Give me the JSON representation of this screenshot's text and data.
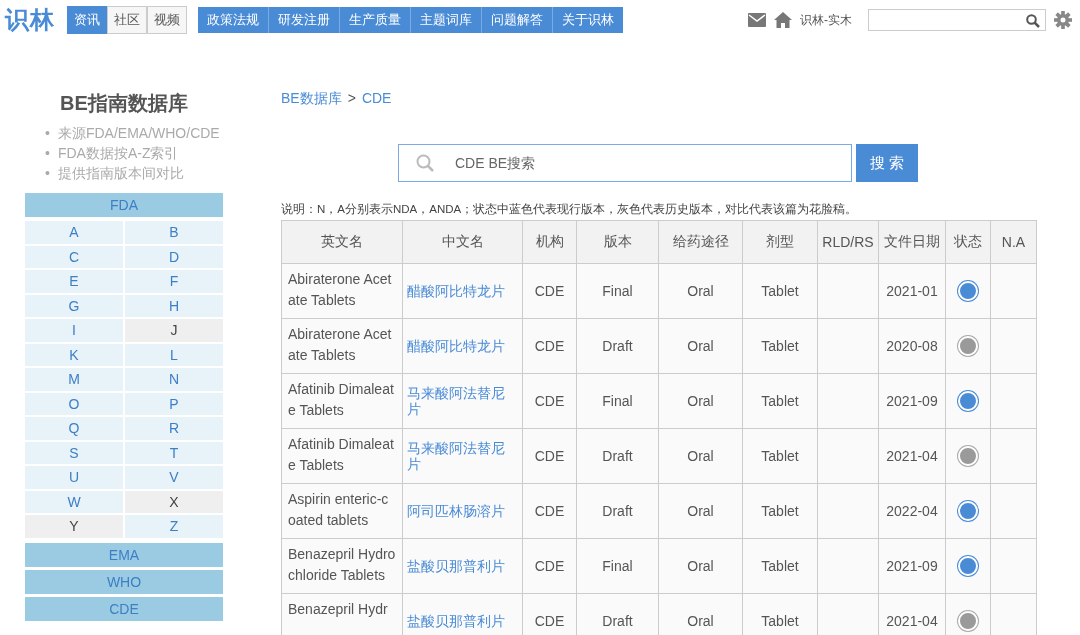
{
  "header": {
    "logo": "识林",
    "tabs": [
      {
        "label": "资讯",
        "selected": true
      },
      {
        "label": "社区",
        "selected": false
      },
      {
        "label": "视频",
        "selected": false
      }
    ],
    "nav": [
      "政策法规",
      "研发注册",
      "生产质量",
      "主题词库",
      "问题解答",
      "关于识林"
    ],
    "user": "识林-实木"
  },
  "sidebar": {
    "title": "BE指南数据库",
    "bullet_marker": "•",
    "bullets": [
      "来源FDA/EMA/WHO/CDE",
      "FDA数据按A-Z索引",
      "提供指南版本间对比"
    ],
    "fda": "FDA",
    "letters": [
      {
        "label": "A",
        "available": true
      },
      {
        "label": "B",
        "available": true
      },
      {
        "label": "C",
        "available": true
      },
      {
        "label": "D",
        "available": true
      },
      {
        "label": "E",
        "available": true
      },
      {
        "label": "F",
        "available": true
      },
      {
        "label": "G",
        "available": true
      },
      {
        "label": "H",
        "available": true
      },
      {
        "label": "I",
        "available": true
      },
      {
        "label": "J",
        "available": false
      },
      {
        "label": "K",
        "available": true
      },
      {
        "label": "L",
        "available": true
      },
      {
        "label": "M",
        "available": true
      },
      {
        "label": "N",
        "available": true
      },
      {
        "label": "O",
        "available": true
      },
      {
        "label": "P",
        "available": true
      },
      {
        "label": "Q",
        "available": true
      },
      {
        "label": "R",
        "available": true
      },
      {
        "label": "S",
        "available": true
      },
      {
        "label": "T",
        "available": true
      },
      {
        "label": "U",
        "available": true
      },
      {
        "label": "V",
        "available": true
      },
      {
        "label": "W",
        "available": true
      },
      {
        "label": "X",
        "available": false
      },
      {
        "label": "Y",
        "available": false
      },
      {
        "label": "Z",
        "available": true
      }
    ],
    "sources": [
      "EMA",
      "WHO",
      "CDE"
    ]
  },
  "breadcrumb": [
    "BE数据库",
    "CDE"
  ],
  "breadcrumb_separator": ">",
  "search": {
    "placeholder": "CDE BE搜索",
    "button": "搜 索"
  },
  "note": "说明：N，A分别表示NDA，ANDA；状态中蓝色代表现行版本，灰色代表历史版本，对比代表该篇为花脸稿。",
  "table": {
    "columns": [
      "英文名",
      "中文名",
      "机构",
      "版本",
      "给药途径",
      "剂型",
      "RLD/RS",
      "文件日期",
      "状态",
      "N.A"
    ],
    "rows": [
      {
        "en": "Abiraterone Acetate Tablets",
        "cn": "醋酸阿比特龙片",
        "agency": "CDE",
        "version": "Final",
        "route": "Oral",
        "form": "Tablet",
        "date": "2021-01",
        "current": true
      },
      {
        "en": "Abiraterone Acetate Tablets",
        "cn": "醋酸阿比特龙片",
        "agency": "CDE",
        "version": "Draft",
        "route": "Oral",
        "form": "Tablet",
        "date": "2020-08",
        "current": false
      },
      {
        "en": "Afatinib Dimaleate Tablets",
        "cn": "马来酸阿法替尼片",
        "agency": "CDE",
        "version": "Final",
        "route": "Oral",
        "form": "Tablet",
        "date": "2021-09",
        "current": true
      },
      {
        "en": "Afatinib Dimaleate Tablets",
        "cn": "马来酸阿法替尼片",
        "agency": "CDE",
        "version": "Draft",
        "route": "Oral",
        "form": "Tablet",
        "date": "2021-04",
        "current": false
      },
      {
        "en": "Aspirin enteric-coated tablets",
        "cn": "阿司匹林肠溶片",
        "agency": "CDE",
        "version": "Draft",
        "route": "Oral",
        "form": "Tablet",
        "date": "2022-04",
        "current": true
      },
      {
        "en": "Benazepril Hydrochloride Tablets",
        "cn": "盐酸贝那普利片",
        "agency": "CDE",
        "version": "Final",
        "route": "Oral",
        "form": "Tablet",
        "date": "2021-09",
        "current": true
      },
      {
        "en": "Benazepril Hydr",
        "cn": "盐酸贝那普利片",
        "agency": "CDE",
        "version": "Draft",
        "route": "Oral",
        "form": "Tablet",
        "date": "2021-04",
        "current": false
      }
    ]
  }
}
